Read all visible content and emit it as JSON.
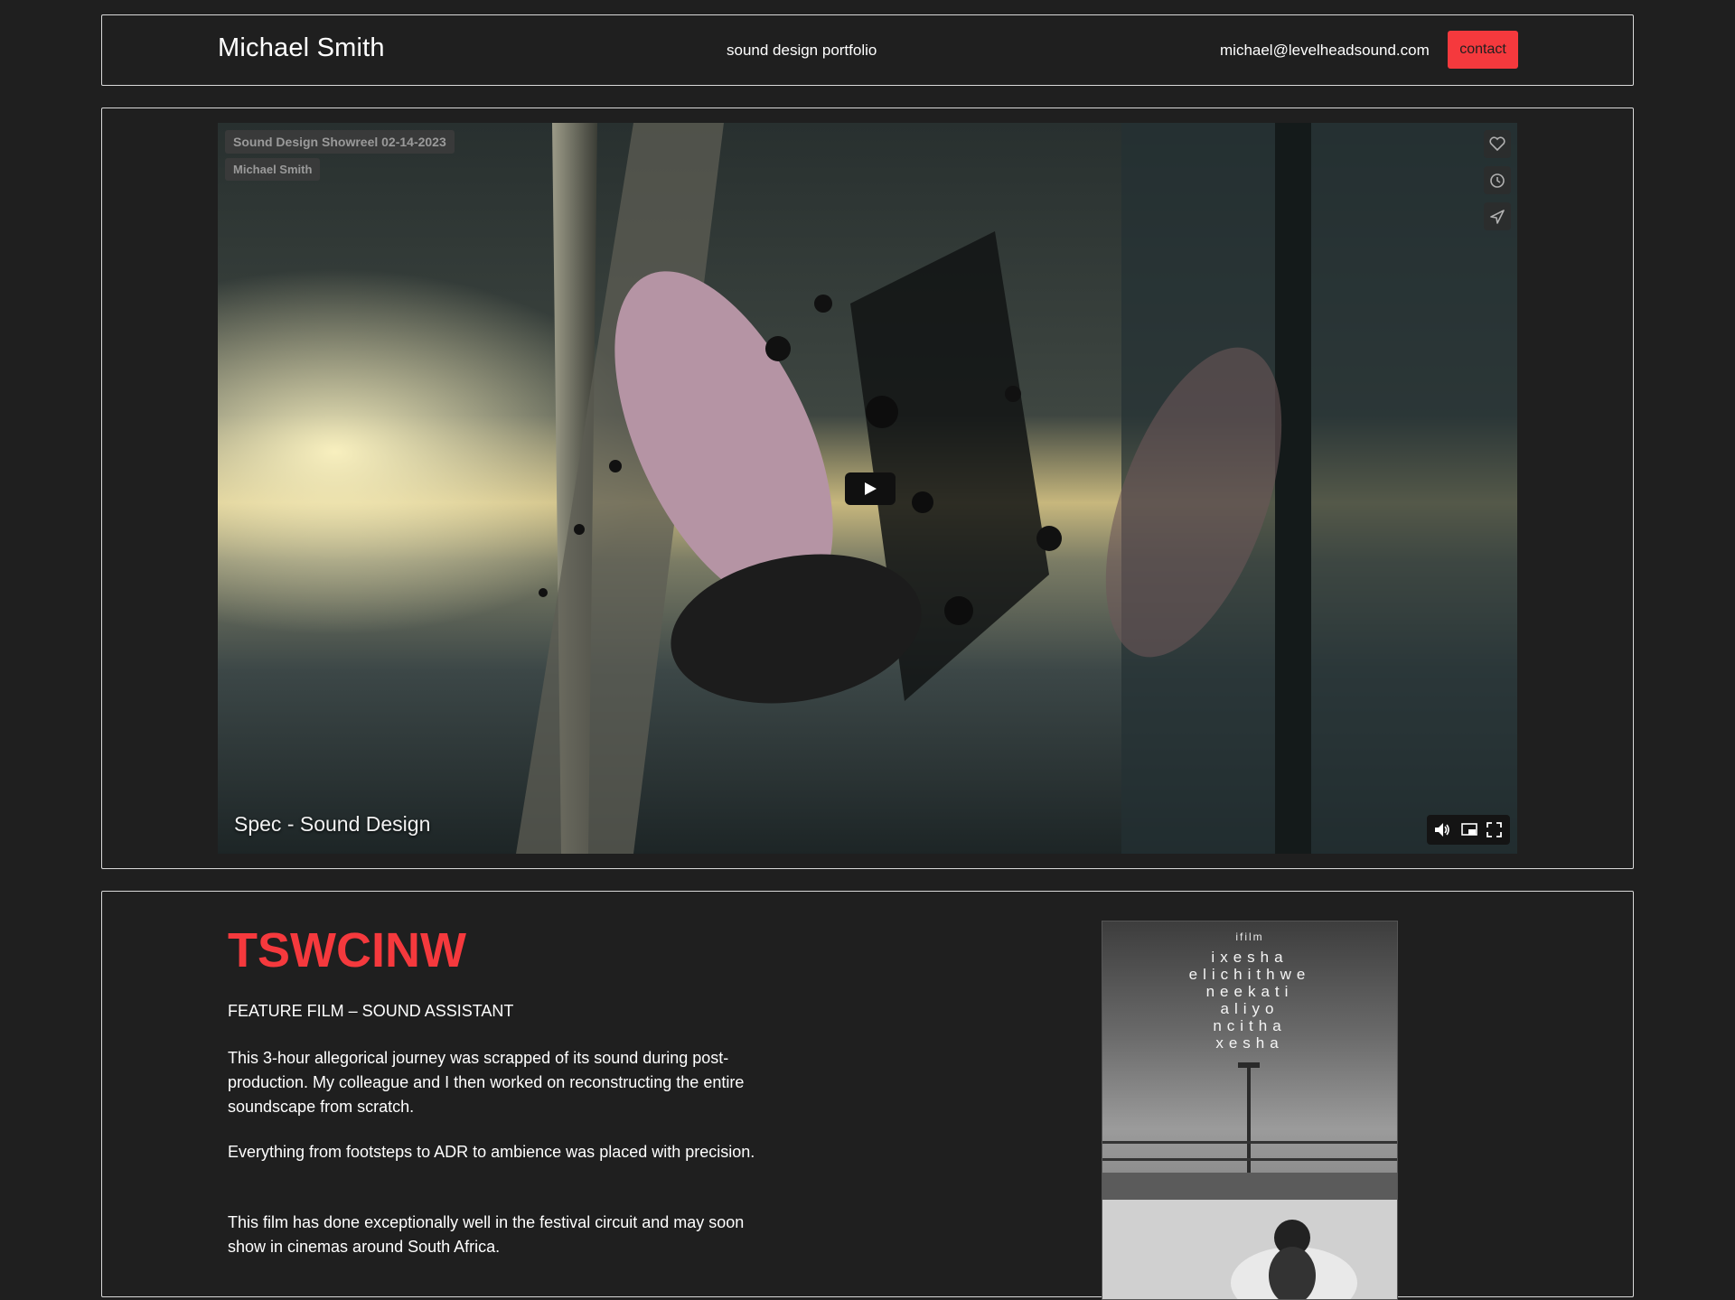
{
  "header": {
    "name": "Michael Smith",
    "tagline": "sound design portfolio",
    "email": "michael@levelheadsound.com",
    "contact_label": "contact",
    "accent_color": "#f5393d"
  },
  "video": {
    "title": "Sound Design Showreel 02-14-2023",
    "author": "Michael Smith",
    "caption": "Spec - Sound Design",
    "side_icons": [
      "heart-icon",
      "clock-icon",
      "share-icon"
    ],
    "control_icons": [
      "volume-icon",
      "picture-in-picture-icon",
      "fullscreen-icon"
    ],
    "play_icon": "play-icon"
  },
  "project": {
    "title": "TSWCINW",
    "role": "FEATURE FILM – SOUND ASSISTANT",
    "paragraphs": [
      "This 3-hour allegorical journey was scrapped of its sound during post-production. My colleague and I then worked on reconstructing the entire soundscape from scratch.",
      "Everything from footsteps to ADR to ambience was placed with precision.",
      "This film has done exceptionally well in the festival circuit and may soon show in cinemas around South Africa."
    ],
    "poster": {
      "brand": "ifilm",
      "lines": [
        "ixesha",
        "elichithwe",
        "neekati",
        "aliyo",
        "ncitha",
        "xesha"
      ]
    }
  }
}
